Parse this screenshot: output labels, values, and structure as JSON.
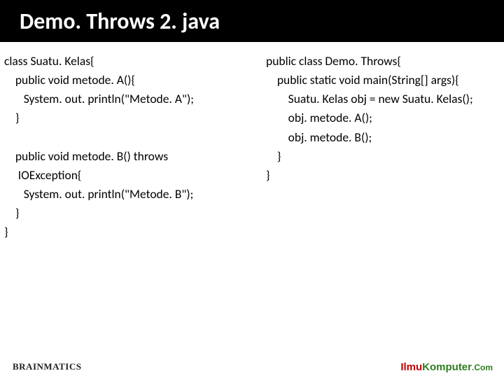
{
  "title": "Demo. Throws 2. java",
  "code_left": "class Suatu. Kelas{\n    public void metode. A(){\n       System. out. println(\"Metode. A\");\n    }\n\n    public void metode. B() throws\n     IOException{\n       System. out. println(\"Metode. B\");\n    }\n}",
  "code_right": "public class Demo. Throws{\n    public static void main(String[] args){\n        Suatu. Kelas obj = new Suatu. Kelas();\n        obj. metode. A();\n        obj. metode. B();\n    }\n}",
  "footer": {
    "left_brand": "BRAINMATICS",
    "left_tag": "",
    "right_ilmu": "Ilmu",
    "right_komputer": "Komputer",
    "right_com": ".Com",
    "right_tag": ""
  }
}
